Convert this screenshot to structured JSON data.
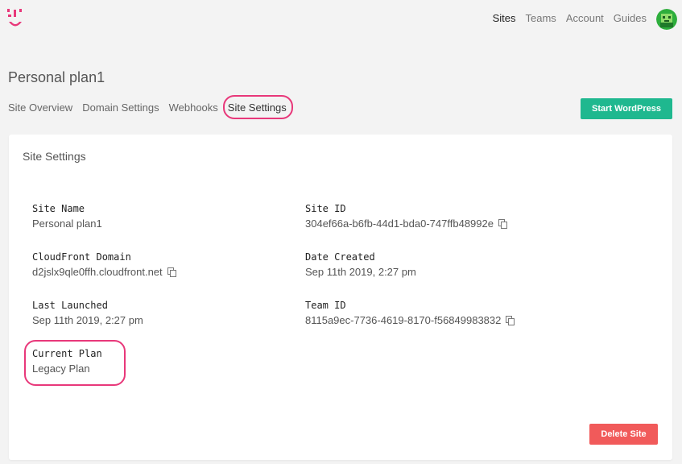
{
  "nav": {
    "items": [
      "Sites",
      "Teams",
      "Account",
      "Guides"
    ],
    "active": "Sites"
  },
  "page": {
    "title": "Personal plan1"
  },
  "subtabs": [
    "Site Overview",
    "Domain Settings",
    "Webhooks",
    "Site Settings"
  ],
  "actions": {
    "start_label": "Start WordPress",
    "delete_label": "Delete Site"
  },
  "card": {
    "title": "Site Settings",
    "fields": {
      "site_name": {
        "label": "Site Name",
        "value": "Personal plan1"
      },
      "site_id": {
        "label": "Site ID",
        "value": "304ef66a-b6fb-44d1-bda0-747ffb48992e"
      },
      "cloudfront_domain": {
        "label": "CloudFront Domain",
        "value": "d2jslx9qle0ffh.cloudfront.net"
      },
      "date_created": {
        "label": "Date Created",
        "value": "Sep 11th 2019, 2:27 pm"
      },
      "last_launched": {
        "label": "Last Launched",
        "value": "Sep 11th 2019, 2:27 pm"
      },
      "team_id": {
        "label": "Team ID",
        "value": "8115a9ec-7736-4619-8170-f56849983832"
      },
      "current_plan": {
        "label": "Current Plan",
        "value": "Legacy Plan"
      }
    }
  },
  "colors": {
    "brand": "#e8387a",
    "primary_button": "#1fb88f",
    "danger_button": "#f15a5a",
    "highlight": "#e8387a"
  },
  "icons": {
    "logo": "brand-logo-icon",
    "avatar": "user-avatar",
    "copy": "copy-icon"
  }
}
